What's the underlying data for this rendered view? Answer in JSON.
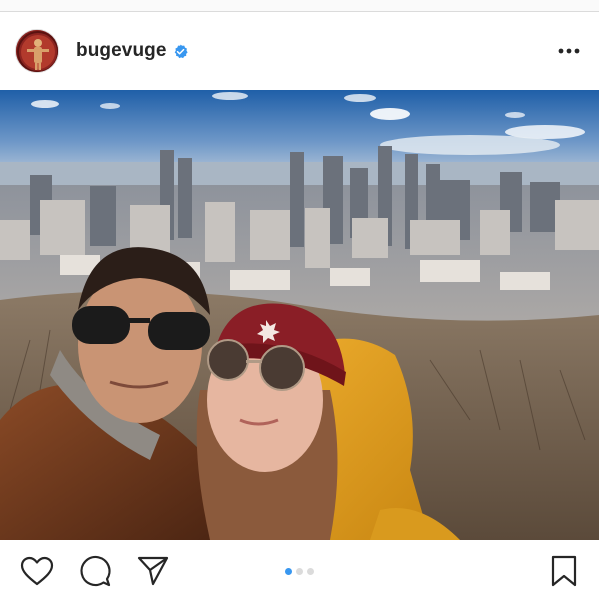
{
  "post": {
    "username": "bugevuge",
    "verified": true,
    "verified_color": "#3897f0",
    "avatar_icon": "profile-avatar",
    "more_icon": "more-horizontal-icon"
  },
  "media": {
    "description_icon": "photo",
    "carousel": {
      "count": 3,
      "active_index": 0,
      "active_color": "#3897f0",
      "inactive_color": "#dbdbdb"
    }
  },
  "actions": {
    "like_icon": "heart-icon",
    "comment_icon": "comment-icon",
    "share_icon": "share-icon",
    "save_icon": "bookmark-icon"
  }
}
